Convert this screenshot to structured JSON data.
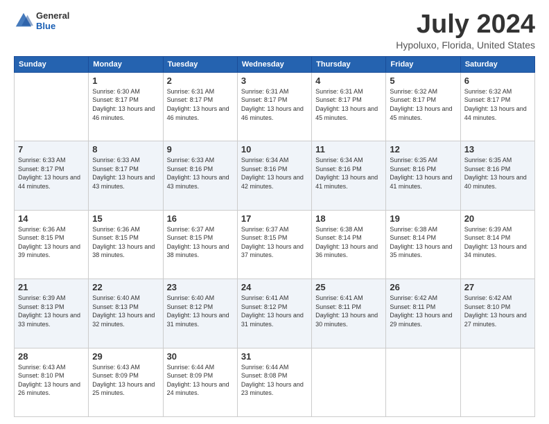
{
  "header": {
    "logo_general": "General",
    "logo_blue": "Blue",
    "month_title": "July 2024",
    "location": "Hypoluxo, Florida, United States"
  },
  "days_of_week": [
    "Sunday",
    "Monday",
    "Tuesday",
    "Wednesday",
    "Thursday",
    "Friday",
    "Saturday"
  ],
  "weeks": [
    [
      {
        "day": "",
        "sunrise": "",
        "sunset": "",
        "daylight": ""
      },
      {
        "day": "1",
        "sunrise": "Sunrise: 6:30 AM",
        "sunset": "Sunset: 8:17 PM",
        "daylight": "Daylight: 13 hours and 46 minutes."
      },
      {
        "day": "2",
        "sunrise": "Sunrise: 6:31 AM",
        "sunset": "Sunset: 8:17 PM",
        "daylight": "Daylight: 13 hours and 46 minutes."
      },
      {
        "day": "3",
        "sunrise": "Sunrise: 6:31 AM",
        "sunset": "Sunset: 8:17 PM",
        "daylight": "Daylight: 13 hours and 46 minutes."
      },
      {
        "day": "4",
        "sunrise": "Sunrise: 6:31 AM",
        "sunset": "Sunset: 8:17 PM",
        "daylight": "Daylight: 13 hours and 45 minutes."
      },
      {
        "day": "5",
        "sunrise": "Sunrise: 6:32 AM",
        "sunset": "Sunset: 8:17 PM",
        "daylight": "Daylight: 13 hours and 45 minutes."
      },
      {
        "day": "6",
        "sunrise": "Sunrise: 6:32 AM",
        "sunset": "Sunset: 8:17 PM",
        "daylight": "Daylight: 13 hours and 44 minutes."
      }
    ],
    [
      {
        "day": "7",
        "sunrise": "Sunrise: 6:33 AM",
        "sunset": "Sunset: 8:17 PM",
        "daylight": "Daylight: 13 hours and 44 minutes."
      },
      {
        "day": "8",
        "sunrise": "Sunrise: 6:33 AM",
        "sunset": "Sunset: 8:17 PM",
        "daylight": "Daylight: 13 hours and 43 minutes."
      },
      {
        "day": "9",
        "sunrise": "Sunrise: 6:33 AM",
        "sunset": "Sunset: 8:16 PM",
        "daylight": "Daylight: 13 hours and 43 minutes."
      },
      {
        "day": "10",
        "sunrise": "Sunrise: 6:34 AM",
        "sunset": "Sunset: 8:16 PM",
        "daylight": "Daylight: 13 hours and 42 minutes."
      },
      {
        "day": "11",
        "sunrise": "Sunrise: 6:34 AM",
        "sunset": "Sunset: 8:16 PM",
        "daylight": "Daylight: 13 hours and 41 minutes."
      },
      {
        "day": "12",
        "sunrise": "Sunrise: 6:35 AM",
        "sunset": "Sunset: 8:16 PM",
        "daylight": "Daylight: 13 hours and 41 minutes."
      },
      {
        "day": "13",
        "sunrise": "Sunrise: 6:35 AM",
        "sunset": "Sunset: 8:16 PM",
        "daylight": "Daylight: 13 hours and 40 minutes."
      }
    ],
    [
      {
        "day": "14",
        "sunrise": "Sunrise: 6:36 AM",
        "sunset": "Sunset: 8:15 PM",
        "daylight": "Daylight: 13 hours and 39 minutes."
      },
      {
        "day": "15",
        "sunrise": "Sunrise: 6:36 AM",
        "sunset": "Sunset: 8:15 PM",
        "daylight": "Daylight: 13 hours and 38 minutes."
      },
      {
        "day": "16",
        "sunrise": "Sunrise: 6:37 AM",
        "sunset": "Sunset: 8:15 PM",
        "daylight": "Daylight: 13 hours and 38 minutes."
      },
      {
        "day": "17",
        "sunrise": "Sunrise: 6:37 AM",
        "sunset": "Sunset: 8:15 PM",
        "daylight": "Daylight: 13 hours and 37 minutes."
      },
      {
        "day": "18",
        "sunrise": "Sunrise: 6:38 AM",
        "sunset": "Sunset: 8:14 PM",
        "daylight": "Daylight: 13 hours and 36 minutes."
      },
      {
        "day": "19",
        "sunrise": "Sunrise: 6:38 AM",
        "sunset": "Sunset: 8:14 PM",
        "daylight": "Daylight: 13 hours and 35 minutes."
      },
      {
        "day": "20",
        "sunrise": "Sunrise: 6:39 AM",
        "sunset": "Sunset: 8:14 PM",
        "daylight": "Daylight: 13 hours and 34 minutes."
      }
    ],
    [
      {
        "day": "21",
        "sunrise": "Sunrise: 6:39 AM",
        "sunset": "Sunset: 8:13 PM",
        "daylight": "Daylight: 13 hours and 33 minutes."
      },
      {
        "day": "22",
        "sunrise": "Sunrise: 6:40 AM",
        "sunset": "Sunset: 8:13 PM",
        "daylight": "Daylight: 13 hours and 32 minutes."
      },
      {
        "day": "23",
        "sunrise": "Sunrise: 6:40 AM",
        "sunset": "Sunset: 8:12 PM",
        "daylight": "Daylight: 13 hours and 31 minutes."
      },
      {
        "day": "24",
        "sunrise": "Sunrise: 6:41 AM",
        "sunset": "Sunset: 8:12 PM",
        "daylight": "Daylight: 13 hours and 31 minutes."
      },
      {
        "day": "25",
        "sunrise": "Sunrise: 6:41 AM",
        "sunset": "Sunset: 8:11 PM",
        "daylight": "Daylight: 13 hours and 30 minutes."
      },
      {
        "day": "26",
        "sunrise": "Sunrise: 6:42 AM",
        "sunset": "Sunset: 8:11 PM",
        "daylight": "Daylight: 13 hours and 29 minutes."
      },
      {
        "day": "27",
        "sunrise": "Sunrise: 6:42 AM",
        "sunset": "Sunset: 8:10 PM",
        "daylight": "Daylight: 13 hours and 27 minutes."
      }
    ],
    [
      {
        "day": "28",
        "sunrise": "Sunrise: 6:43 AM",
        "sunset": "Sunset: 8:10 PM",
        "daylight": "Daylight: 13 hours and 26 minutes."
      },
      {
        "day": "29",
        "sunrise": "Sunrise: 6:43 AM",
        "sunset": "Sunset: 8:09 PM",
        "daylight": "Daylight: 13 hours and 25 minutes."
      },
      {
        "day": "30",
        "sunrise": "Sunrise: 6:44 AM",
        "sunset": "Sunset: 8:09 PM",
        "daylight": "Daylight: 13 hours and 24 minutes."
      },
      {
        "day": "31",
        "sunrise": "Sunrise: 6:44 AM",
        "sunset": "Sunset: 8:08 PM",
        "daylight": "Daylight: 13 hours and 23 minutes."
      },
      {
        "day": "",
        "sunrise": "",
        "sunset": "",
        "daylight": ""
      },
      {
        "day": "",
        "sunrise": "",
        "sunset": "",
        "daylight": ""
      },
      {
        "day": "",
        "sunrise": "",
        "sunset": "",
        "daylight": ""
      }
    ]
  ]
}
